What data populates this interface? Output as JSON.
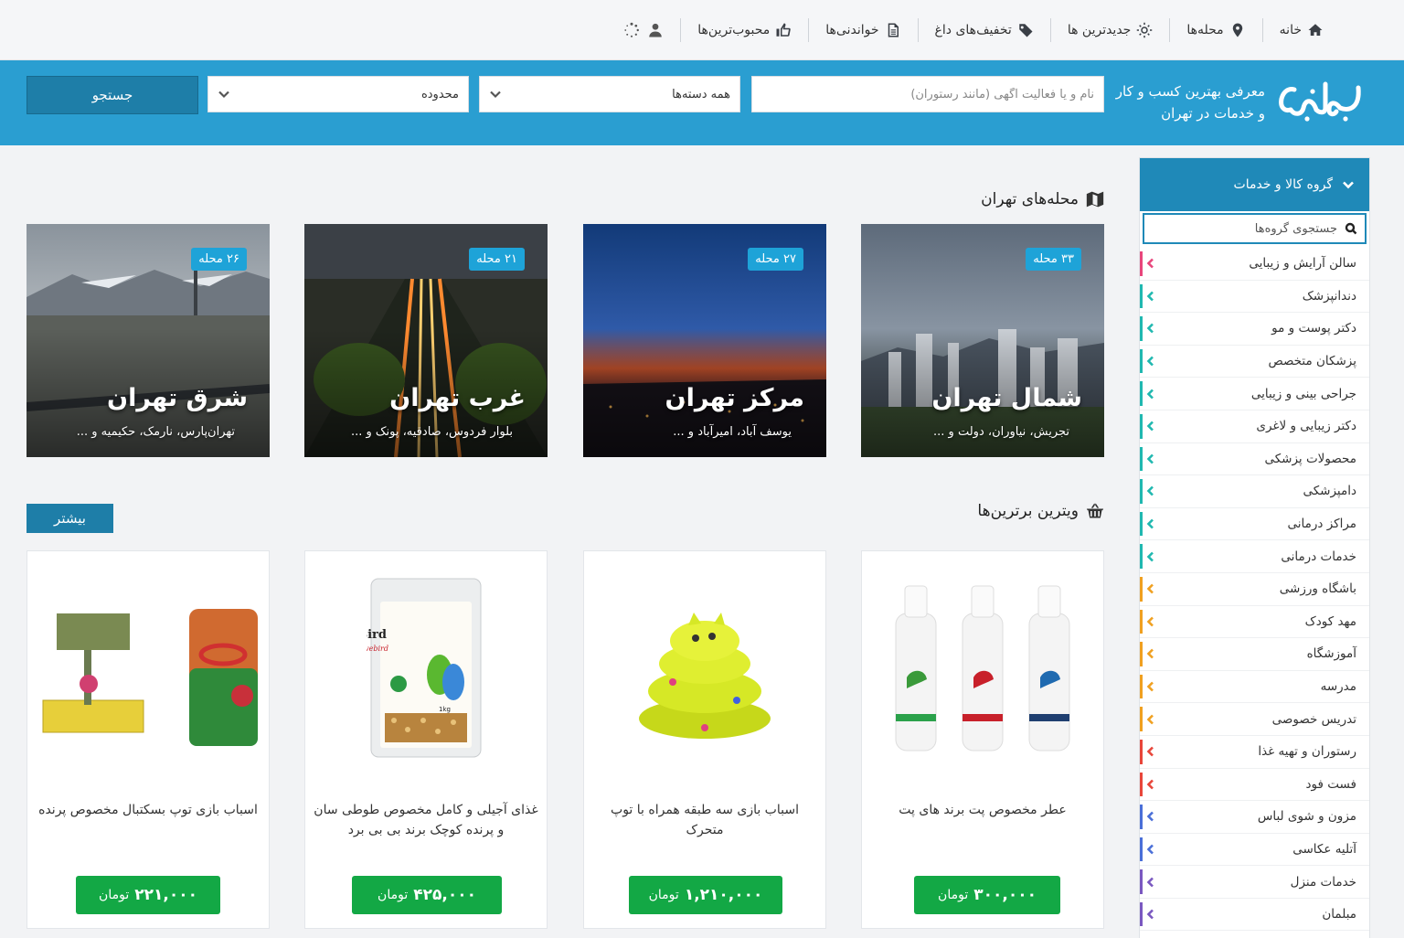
{
  "topnav": {
    "items": [
      {
        "label": "خانه",
        "icon": "home-icon"
      },
      {
        "label": "محله‌ها",
        "icon": "map-marker-icon"
      },
      {
        "label": "جدیدترین ها",
        "icon": "sun-icon"
      },
      {
        "label": "تخفیف‌های داغ",
        "icon": "tag-icon"
      },
      {
        "label": "خواندنی‌ها",
        "icon": "document-icon"
      },
      {
        "label": "محبوب‌ترین‌ها",
        "icon": "thumbs-up-icon"
      }
    ]
  },
  "header": {
    "tagline": "معرفی بهترین کسب و کار و خدمات در تهران",
    "search_placeholder": "نام و یا فعالیت آگهی (مانند رستوران)",
    "category_select": "همه دسته‌ها",
    "area_select": "محدوده",
    "search_button": "جستجو"
  },
  "sidebar": {
    "title": "گروه کالا و خدمات",
    "search_placeholder": "جستجوی گروه‌ها",
    "items": [
      {
        "label": "سالن آرایش و زیبایی",
        "color": "#e8467c"
      },
      {
        "label": "دندانپزشک",
        "color": "#20b8b0"
      },
      {
        "label": "دکتر پوست و مو",
        "color": "#20b8b0"
      },
      {
        "label": "پزشکان متخصص",
        "color": "#20b8b0"
      },
      {
        "label": "جراحی بینی و زیبایی",
        "color": "#20b8b0"
      },
      {
        "label": "دکتر زیبایی و لاغری",
        "color": "#20b8b0"
      },
      {
        "label": "محصولات پزشکی",
        "color": "#20b8b0"
      },
      {
        "label": "دامپزشکی",
        "color": "#20b8b0"
      },
      {
        "label": "مراکز درمانی",
        "color": "#20b8b0"
      },
      {
        "label": "خدمات درمانی",
        "color": "#20b8b0"
      },
      {
        "label": "باشگاه ورزشی",
        "color": "#f0a020"
      },
      {
        "label": "مهد کودک",
        "color": "#f0a020"
      },
      {
        "label": "آموزشگاه",
        "color": "#f0a020"
      },
      {
        "label": "مدرسه",
        "color": "#f0a020"
      },
      {
        "label": "تدریس خصوصی",
        "color": "#f0a020"
      },
      {
        "label": "رستوران و تهیه غذا",
        "color": "#e8463a"
      },
      {
        "label": "فست فود",
        "color": "#e8463a"
      },
      {
        "label": "مزون و شوی لباس",
        "color": "#4a6fd8"
      },
      {
        "label": "آتلیه عکاسی",
        "color": "#4a6fd8"
      },
      {
        "label": "خدمات منزل",
        "color": "#7a58c0"
      },
      {
        "label": "مبلمان",
        "color": "#7a58c0"
      }
    ]
  },
  "neighborhoods": {
    "title": "محله‌های تهران",
    "cards": [
      {
        "name": "شمال تهران",
        "badge": "۳۳ محله",
        "sub": "تجریش، نیاوران، دولت و ..."
      },
      {
        "name": "مرکز تهران",
        "badge": "۲۷ محله",
        "sub": "یوسف آباد، امیرآباد و ..."
      },
      {
        "name": "غرب تهران",
        "badge": "۲۱ محله",
        "sub": "بلوار فردوس، صادقیه، پونک و ..."
      },
      {
        "name": "شرق تهران",
        "badge": "۲۶ محله",
        "sub": "تهران‌پارس، نارمک، حکیمیه و ..."
      }
    ]
  },
  "showcase": {
    "title": "ویترین برترین‌ها",
    "more": "بیشتر",
    "products": [
      {
        "title": "عطر مخصوص پت برند های پت",
        "price": "۳۰۰,۰۰۰",
        "currency": "تومان"
      },
      {
        "title": "اسباب بازی سه طبقه همراه با توپ متحرک",
        "price": "۱,۲۱۰,۰۰۰",
        "currency": "تومان"
      },
      {
        "title": "غذای آجیلی و کامل مخصوص طوطی سان و پرنده کوچک برند بی بی برد",
        "price": "۴۲۵,۰۰۰",
        "currency": "تومان"
      },
      {
        "title": "اسباب بازی توپ بسکتبال مخصوص پرنده",
        "price": "۲۲۱,۰۰۰",
        "currency": "تومان"
      }
    ],
    "package_text": {
      "brand": "Baby Bird",
      "sub": "Lovebird",
      "weight": "1kg"
    }
  }
}
